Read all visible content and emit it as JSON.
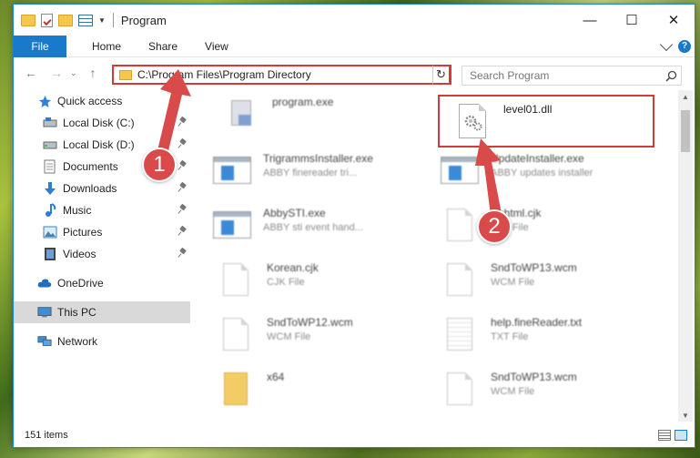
{
  "window": {
    "title": "Program",
    "minimize": "—",
    "maximize": "☐",
    "close": "✕"
  },
  "ribbon": {
    "tabs": [
      "File",
      "Home",
      "Share",
      "View"
    ],
    "help": "?"
  },
  "address": {
    "path": "C:\\Program Files\\Program Directory",
    "search_placeholder": "Search Program"
  },
  "nav": [
    {
      "label": "Quick access",
      "icon": "star-icon",
      "pinned": false,
      "indent": false
    },
    {
      "label": "Local Disk (C:)",
      "icon": "drive-icon",
      "pinned": true,
      "indent": true
    },
    {
      "label": "Local Disk (D:)",
      "icon": "drive-icon",
      "pinned": true,
      "indent": true
    },
    {
      "label": "Documents",
      "icon": "documents-icon",
      "pinned": true,
      "indent": true
    },
    {
      "label": "Downloads",
      "icon": "download-icon",
      "pinned": true,
      "indent": true
    },
    {
      "label": "Music",
      "icon": "music-icon",
      "pinned": true,
      "indent": true
    },
    {
      "label": "Pictures",
      "icon": "pictures-icon",
      "pinned": true,
      "indent": true
    },
    {
      "label": "Videos",
      "icon": "videos-icon",
      "pinned": true,
      "indent": true
    },
    {
      "label": "OneDrive",
      "icon": "cloud-icon",
      "pinned": false,
      "indent": false
    },
    {
      "label": "This PC",
      "icon": "computer-icon",
      "pinned": false,
      "indent": false,
      "selected": true
    },
    {
      "label": "Network",
      "icon": "network-icon",
      "pinned": false,
      "indent": false
    }
  ],
  "files": {
    "program_exe": {
      "name": "program.exe",
      "sub": ""
    },
    "level01_dll": {
      "name": "level01.dll",
      "sub": ""
    },
    "trigramms": {
      "name": "TrigrammsInstaller.exe",
      "sub": "ABBY finereader tri..."
    },
    "update": {
      "name": "UpdateInstaller.exe",
      "sub": "ABBY updates installer"
    },
    "abbysti": {
      "name": "AbbySTI.exe",
      "sub": "ABBY sti event hand..."
    },
    "ushtml": {
      "name": "Ushtml.cjk",
      "sub": "CJK File"
    },
    "korean": {
      "name": "Korean.cjk",
      "sub": "CJK File"
    },
    "sndtowp13": {
      "name": "SndToWP13.wcm",
      "sub": "WCM File"
    },
    "sndtowp12": {
      "name": "SndToWP12.wcm",
      "sub": "WCM File"
    },
    "help": {
      "name": "help.fineReader.txt",
      "sub": "TXT File"
    },
    "x64": {
      "name": "x64",
      "sub": ""
    },
    "sndtowp13b": {
      "name": "SndToWP13.wcm",
      "sub": "WCM File"
    }
  },
  "status": {
    "items": "151 items"
  },
  "callouts": [
    "1",
    "2"
  ],
  "colors": {
    "accent": "#1979ca",
    "highlight": "#d33b3b",
    "callout": "#d94b4b"
  }
}
